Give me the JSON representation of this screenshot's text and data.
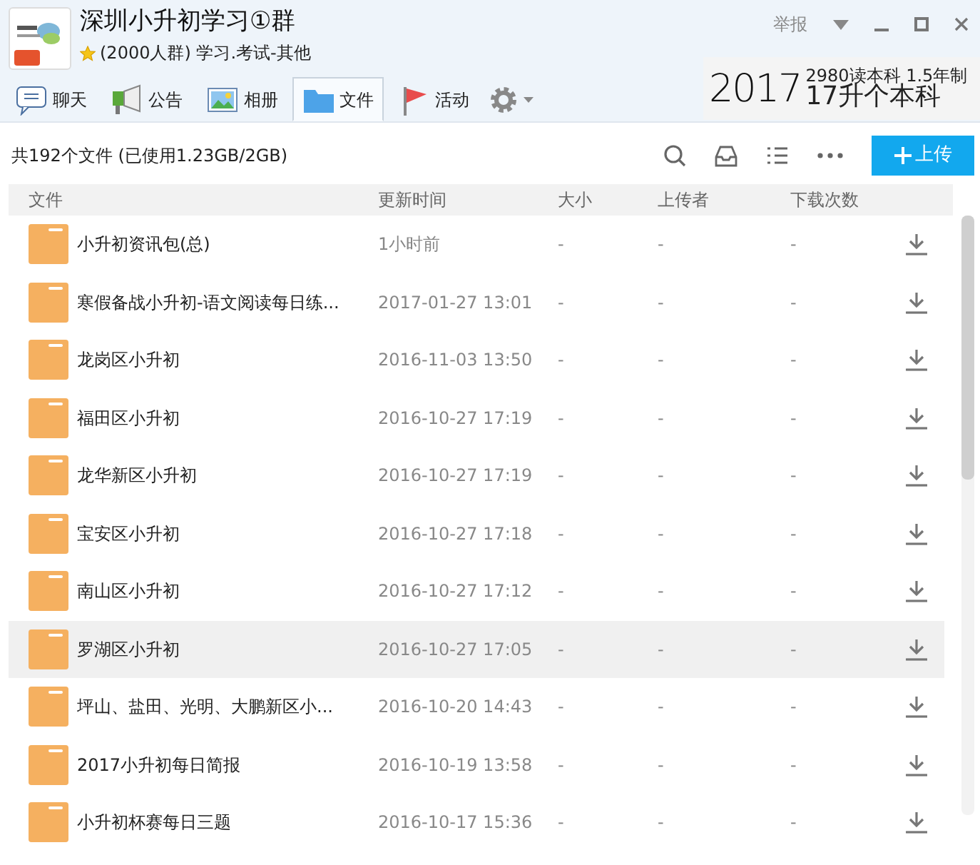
{
  "group": {
    "name": "深圳小升初学习①群",
    "info": "(2000人群) 学习.考试-其他",
    "report": "举报"
  },
  "tabs": [
    {
      "label": "聊天",
      "kind": "chat",
      "selected": false
    },
    {
      "label": "公告",
      "kind": "announce",
      "selected": false
    },
    {
      "label": "相册",
      "kind": "album",
      "selected": false
    },
    {
      "label": "文件",
      "kind": "folder",
      "selected": true
    },
    {
      "label": "活动",
      "kind": "flag",
      "selected": false
    }
  ],
  "ad_banner": {
    "year": "2017",
    "line1": "2980读本科 1.5年制",
    "line2": "17升个本科"
  },
  "summary": "共192个文件 (已使用1.23GB/2GB)",
  "upload_button": "上传",
  "columns": [
    "文件",
    "更新时间",
    "大小",
    "上传者",
    "下载次数"
  ],
  "rows": [
    {
      "name": "小升初资讯包(总)",
      "updated": "1小时前",
      "size": "-",
      "uploader": "-",
      "downloads": "-",
      "selected": false
    },
    {
      "name": "寒假备战小升初-语文阅读每日练...",
      "updated": "2017-01-27 13:01",
      "size": "-",
      "uploader": "-",
      "downloads": "-",
      "selected": false
    },
    {
      "name": "龙岗区小升初",
      "updated": "2016-11-03 13:50",
      "size": "-",
      "uploader": "-",
      "downloads": "-",
      "selected": false
    },
    {
      "name": "福田区小升初",
      "updated": "2016-10-27 17:19",
      "size": "-",
      "uploader": "-",
      "downloads": "-",
      "selected": false
    },
    {
      "name": "龙华新区小升初",
      "updated": "2016-10-27 17:19",
      "size": "-",
      "uploader": "-",
      "downloads": "-",
      "selected": false
    },
    {
      "name": "宝安区小升初",
      "updated": "2016-10-27 17:18",
      "size": "-",
      "uploader": "-",
      "downloads": "-",
      "selected": false
    },
    {
      "name": "南山区小升初",
      "updated": "2016-10-27 17:12",
      "size": "-",
      "uploader": "-",
      "downloads": "-",
      "selected": false
    },
    {
      "name": "罗湖区小升初",
      "updated": "2016-10-27 17:05",
      "size": "-",
      "uploader": "-",
      "downloads": "-",
      "selected": true
    },
    {
      "name": "坪山、盐田、光明、大鹏新区小...",
      "updated": "2016-10-20 14:43",
      "size": "-",
      "uploader": "-",
      "downloads": "-",
      "selected": false
    },
    {
      "name": "2017小升初每日简报",
      "updated": "2016-10-19 13:58",
      "size": "-",
      "uploader": "-",
      "downloads": "-",
      "selected": false
    },
    {
      "name": "小升初杯赛每日三题",
      "updated": "2016-10-17 15:36",
      "size": "-",
      "uploader": "-",
      "downloads": "-",
      "selected": false
    }
  ]
}
